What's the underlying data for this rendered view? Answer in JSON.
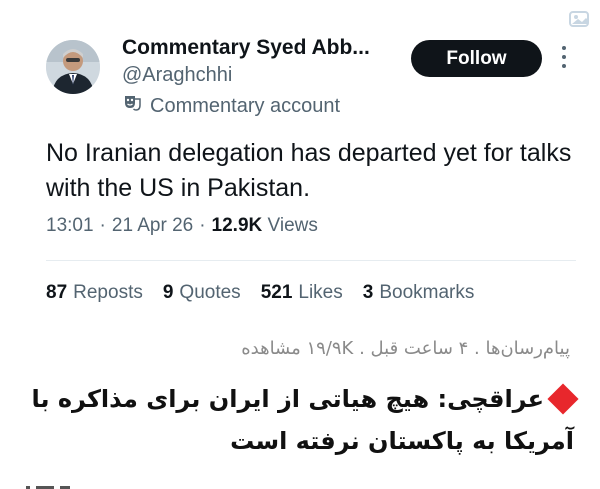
{
  "tweet": {
    "author": {
      "display_name": "Commentary Syed Abb...",
      "handle": "@Araghchhi",
      "account_label": "Commentary account",
      "account_label_icon": "theater-masks-icon",
      "avatar": "avatar-photo"
    },
    "follow_label": "Follow",
    "more_icon": "more-options-icon",
    "text": "No Iranian delegation has departed yet for talks with the US in Pakistan.",
    "time": "13:01",
    "date": "21 Apr 26",
    "views_count": "12.9K",
    "views_label": "Views",
    "separator": "·",
    "stats": [
      {
        "count": "87",
        "label": "Reposts"
      },
      {
        "count": "9",
        "label": "Quotes"
      },
      {
        "count": "521",
        "label": "Likes"
      },
      {
        "count": "3",
        "label": "Bookmarks"
      }
    ]
  },
  "news": {
    "source_line": "پیام‌رسان‌ها . ۴ ساعت قبل . ۱۹/۹K مشاهده",
    "headline": "عراقچی: هیچ هیاتی از ایران برای مذاکره با آمریکا به پاکستان نرفته است",
    "marker_color": "#e8272c",
    "marker_icon": "red-diamond-icon"
  },
  "colors": {
    "follow_bg": "#0f1419",
    "secondary_text": "#536471",
    "primary_text": "#0f1419"
  }
}
